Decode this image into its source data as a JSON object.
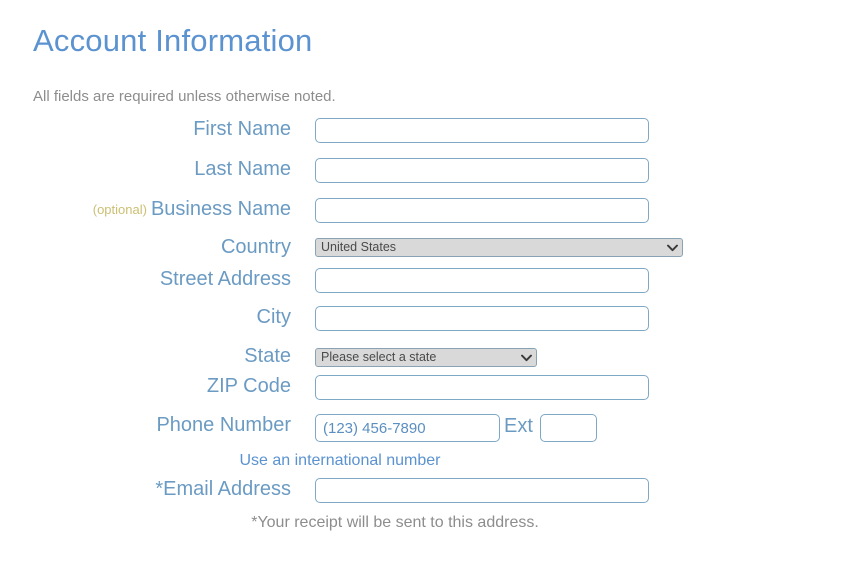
{
  "form": {
    "heading": "Account Information",
    "intro": "All fields are required unless otherwise noted.",
    "fields": {
      "first_name": {
        "label": "First Name",
        "value": ""
      },
      "last_name": {
        "label": "Last Name",
        "value": ""
      },
      "business_name": {
        "label": "Business Name",
        "optional_tag": "(optional)",
        "value": ""
      },
      "country": {
        "label": "Country",
        "selected": "United States"
      },
      "street_address": {
        "label": "Street Address",
        "value": ""
      },
      "city": {
        "label": "City",
        "value": ""
      },
      "state": {
        "label": "State",
        "selected": "Please select a state"
      },
      "zip_code": {
        "label": "ZIP Code",
        "value": ""
      },
      "phone_number": {
        "label": "Phone Number",
        "placeholder": "(123) 456-7890",
        "value": "",
        "ext_label": "Ext",
        "ext_value": ""
      },
      "email_address": {
        "label": "*Email Address",
        "value": ""
      }
    },
    "international_link": "Use an international number",
    "receipt_note": "*Your receipt will be sent to this address."
  },
  "colors": {
    "heading": "#5b92d0",
    "label": "#6b9bc3",
    "optional": "#cbbf72",
    "muted_text": "#8d8d8d",
    "input_border": "#7fa8c4",
    "select_background": "#d9d9d9",
    "link": "#5b92d0"
  }
}
